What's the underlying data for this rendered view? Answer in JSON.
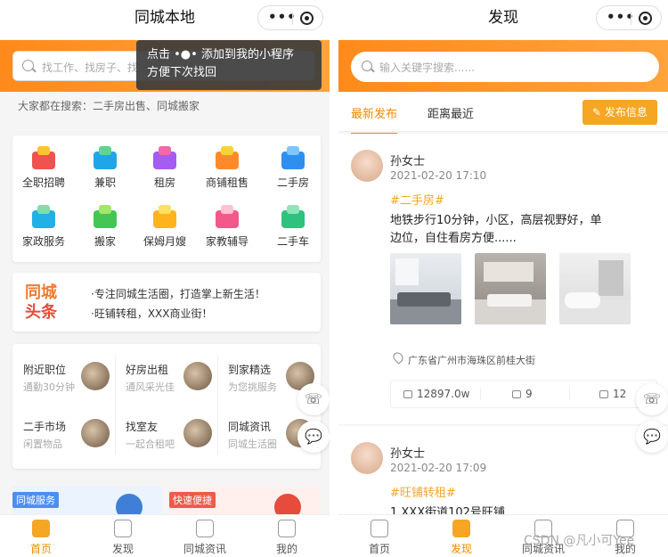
{
  "left": {
    "title": "同城本地",
    "search_placeholder": "找工作、找房子、找",
    "tooltip": {
      "line1": "点击 •●• 添加到我的小程序",
      "line2": "方便下次找回"
    },
    "hot_search": "大家都在搜索：二手房出售、同城搬家",
    "categories": [
      {
        "label": "全职招聘",
        "color": "#f0524f",
        "color2": "#ffc233"
      },
      {
        "label": "兼职",
        "color": "#20a6e8",
        "color2": "#5fd38f"
      },
      {
        "label": "租房",
        "color": "#a55cf0",
        "color2": "#f06aa8"
      },
      {
        "label": "商铺租售",
        "color": "#ff8a2b",
        "color2": "#f5d23a"
      },
      {
        "label": "二手房",
        "color": "#2f8ff0",
        "color2": "#7dc6ff"
      },
      {
        "label": "家政服务",
        "color": "#22b0e6",
        "color2": "#7ee0a6"
      },
      {
        "label": "搬家",
        "color": "#44c654",
        "color2": "#a2e66a"
      },
      {
        "label": "保姆月嫂",
        "color": "#ffb41e",
        "color2": "#ffe066"
      },
      {
        "label": "家教辅导",
        "color": "#f2598a",
        "color2": "#ffc2d2"
      },
      {
        "label": "二手车",
        "color": "#2ec27e",
        "color2": "#8ee6b8"
      }
    ],
    "news": {
      "logo_line1": "同城",
      "logo_line2": "头条",
      "items": [
        "·专注同城生活圈，打造掌上新生活！",
        "·旺铺转租，XXX商业街！"
      ]
    },
    "services": [
      {
        "title": "附近职位",
        "sub": "通勤30分钟"
      },
      {
        "title": "好房出租",
        "sub": "通风采光佳"
      },
      {
        "title": "到家精选",
        "sub": "为您挑服务"
      },
      {
        "title": "二手市场",
        "sub": "闲置物品"
      },
      {
        "title": "找室友",
        "sub": "一起合租吧"
      },
      {
        "title": "同城资讯",
        "sub": "同城生活圈"
      }
    ],
    "promos": [
      {
        "tag": "同城服务",
        "color": "#4f8ef0"
      },
      {
        "tag": "快速便捷",
        "color": "#ef5a4a"
      }
    ],
    "tabs": [
      {
        "label": "首页",
        "active": true
      },
      {
        "label": "发现",
        "active": false
      },
      {
        "label": "同城资讯",
        "active": false
      },
      {
        "label": "我的",
        "active": false
      }
    ]
  },
  "right": {
    "title": "发现",
    "search_placeholder": "输入关键字搜索......",
    "filters": [
      {
        "label": "最新发布",
        "active": true
      },
      {
        "label": "距离最近",
        "active": false
      }
    ],
    "publish_label": "发布信息",
    "posts": [
      {
        "name": "孙女士",
        "time": "2021-02-20 17:10",
        "tag": "#二手房#",
        "body": "地铁步行10分钟，小区，高层视野好，单边位，自住看房方便......",
        "address": "广东省广州市海珠区前桂大街",
        "views": "12897.0w",
        "comments": "9",
        "likes": "12"
      },
      {
        "name": "孙女士",
        "time": "2021-02-20 17:09",
        "tag": "#旺铺转租#",
        "body": "1 XXX街道102号旺铺"
      }
    ],
    "tabs": [
      {
        "label": "首页",
        "active": false
      },
      {
        "label": "发现",
        "active": true
      },
      {
        "label": "同城资讯",
        "active": false
      },
      {
        "label": "我的",
        "active": false
      }
    ]
  },
  "float_buttons": {
    "phone_icon": "phone-icon",
    "chat_icon": "chat-icon"
  },
  "watermark": "CSDN @凡小可Yee",
  "colors": {
    "accent": "#f5a623",
    "accent_text": "#f08a00",
    "banner_start": "#ff8a1c",
    "banner_end": "#ffa33a"
  }
}
